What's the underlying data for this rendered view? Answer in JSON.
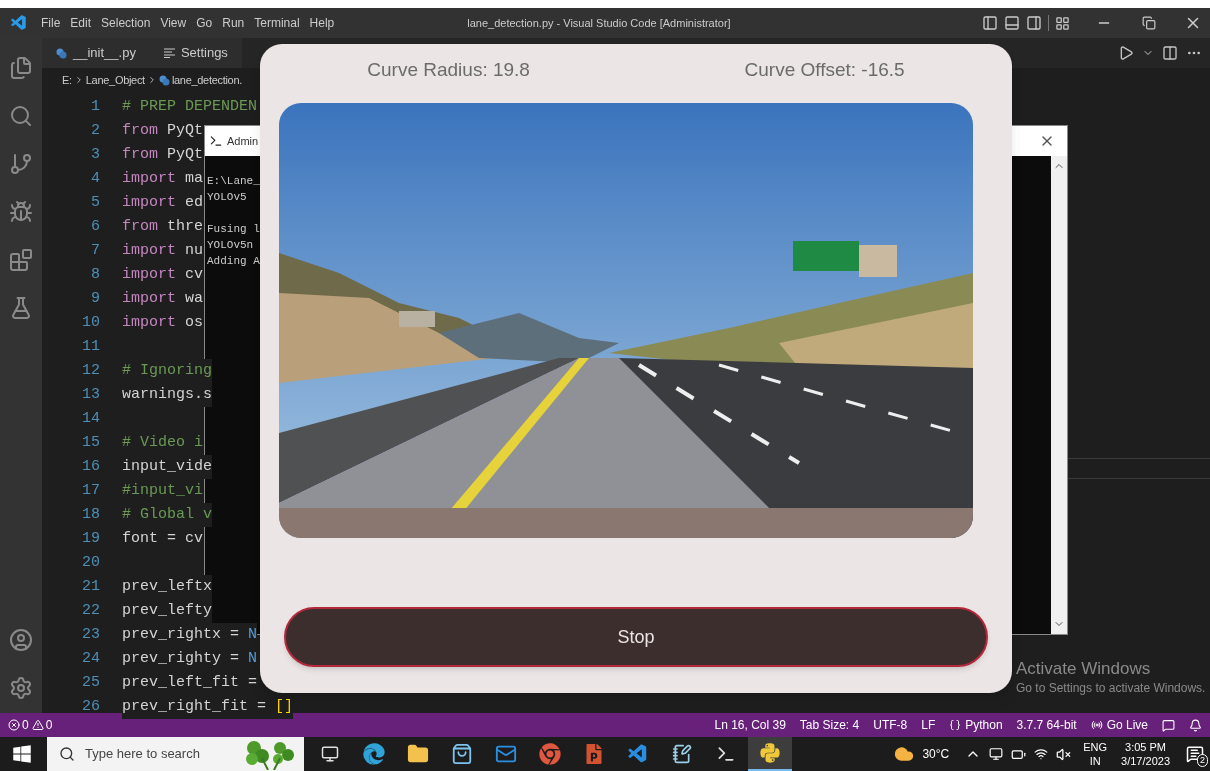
{
  "vscode": {
    "menu": [
      "File",
      "Edit",
      "Selection",
      "View",
      "Go",
      "Run",
      "Terminal",
      "Help"
    ],
    "title": "lane_detection.py - Visual Studio Code [Administrator]",
    "tabs": [
      {
        "label": "__init__.py",
        "kind": "python",
        "selected": false
      },
      {
        "label": "Settings",
        "kind": "settings",
        "selected": false
      }
    ],
    "breadcrumb": [
      {
        "label": "E:",
        "kind": "folder"
      },
      {
        "label": "Lane_Object",
        "kind": "folder"
      },
      {
        "label": "lane_detection.",
        "kind": "python"
      }
    ],
    "code_lines": [
      {
        "number": "1",
        "tokens": [
          {
            "text": "# PREP DEPENDEN",
            "kind": "comment"
          }
        ]
      },
      {
        "number": "2",
        "tokens": [
          {
            "text": "from",
            "kind": "keyword"
          },
          {
            "text": " PyQt",
            "kind": "plain"
          }
        ]
      },
      {
        "number": "3",
        "tokens": [
          {
            "text": "from",
            "kind": "keyword"
          },
          {
            "text": " PyQt",
            "kind": "plain"
          }
        ]
      },
      {
        "number": "4",
        "tokens": [
          {
            "text": "import",
            "kind": "keyword"
          },
          {
            "text": " ma",
            "kind": "plain"
          }
        ]
      },
      {
        "number": "5",
        "tokens": [
          {
            "text": "import",
            "kind": "keyword"
          },
          {
            "text": " ed",
            "kind": "plain"
          }
        ]
      },
      {
        "number": "6",
        "tokens": [
          {
            "text": "from",
            "kind": "keyword"
          },
          {
            "text": " thre",
            "kind": "plain"
          }
        ]
      },
      {
        "number": "7",
        "tokens": [
          {
            "text": "import",
            "kind": "keyword"
          },
          {
            "text": " nu",
            "kind": "plain"
          }
        ]
      },
      {
        "number": "8",
        "tokens": [
          {
            "text": "import",
            "kind": "keyword"
          },
          {
            "text": " cv",
            "kind": "plain"
          }
        ]
      },
      {
        "number": "9",
        "tokens": [
          {
            "text": "import",
            "kind": "keyword"
          },
          {
            "text": " wa",
            "kind": "plain"
          }
        ]
      },
      {
        "number": "10",
        "tokens": [
          {
            "text": "import",
            "kind": "keyword"
          },
          {
            "text": " os",
            "kind": "plain"
          }
        ]
      },
      {
        "number": "11"
      },
      {
        "number": "12",
        "tokens": [
          {
            "text": "# Ignoring",
            "kind": "comment"
          }
        ]
      },
      {
        "number": "13",
        "tokens": [
          {
            "text": "warnings.s",
            "kind": "plain"
          }
        ]
      },
      {
        "number": "14"
      },
      {
        "number": "15",
        "tokens": [
          {
            "text": "# Video i",
            "kind": "comment"
          }
        ]
      },
      {
        "number": "16",
        "tokens": [
          {
            "text": "input_vide",
            "kind": "plain"
          }
        ]
      },
      {
        "number": "17",
        "tokens": [
          {
            "text": "#input_vi",
            "kind": "comment"
          }
        ]
      },
      {
        "number": "18",
        "tokens": [
          {
            "text": "# Global v",
            "kind": "comment"
          }
        ]
      },
      {
        "number": "19",
        "tokens": [
          {
            "text": "font = cv",
            "kind": "plain"
          }
        ]
      },
      {
        "number": "20"
      },
      {
        "number": "21",
        "tokens": [
          {
            "text": "prev_leftx",
            "kind": "plain"
          }
        ]
      },
      {
        "number": "22",
        "tokens": [
          {
            "text": "prev_lefty",
            "kind": "plain"
          }
        ]
      },
      {
        "number": "23",
        "tokens": [
          {
            "text": "prev_rightx = ",
            "kind": "plain"
          },
          {
            "text": "N",
            "kind": "constant"
          }
        ]
      },
      {
        "number": "24",
        "tokens": [
          {
            "text": "prev_righty = ",
            "kind": "plain"
          },
          {
            "text": "N",
            "kind": "constant"
          }
        ]
      },
      {
        "number": "25",
        "tokens": [
          {
            "text": "prev_left_fit =",
            "kind": "plain"
          }
        ]
      },
      {
        "number": "26",
        "tokens": [
          {
            "text": "prev_right_fit = ",
            "kind": "plain"
          },
          {
            "text": "[]",
            "kind": "bracket"
          }
        ]
      }
    ],
    "status_bar": {
      "errors": "0",
      "warnings": "0",
      "items": [
        {
          "label": "Ln 16, Col 39",
          "kind": "text"
        },
        {
          "label": "Tab Size: 4",
          "kind": "text"
        },
        {
          "label": "UTF-8",
          "kind": "text"
        },
        {
          "label": "LF",
          "kind": "text"
        },
        {
          "label": "Python",
          "kind": "language"
        },
        {
          "label": "3.7.7 64-bit",
          "kind": "text"
        },
        {
          "label": "Go Live",
          "kind": "live"
        }
      ]
    }
  },
  "console": {
    "title": "Admin",
    "blocks": [
      [
        "E:\\Lane_",
        "YOLOv5"
      ],
      [
        "Fusing l",
        "YOLOv5n",
        "Adding A"
      ]
    ]
  },
  "app": {
    "curve_radius": "Curve Radius: 19.8",
    "curve_offset": "Curve Offset: -16.5",
    "button": "Stop"
  },
  "activation_notice": {
    "title": "Activate Windows",
    "subtitle": "Go to Settings to activate Windows."
  },
  "taskbar": {
    "search": {
      "placeholder": "Type here to search"
    },
    "apps": [
      {
        "kind": "taskview",
        "selected": false
      },
      {
        "kind": "browser",
        "selected": false
      },
      {
        "kind": "folder",
        "selected": false
      },
      {
        "kind": "store",
        "selected": false
      },
      {
        "kind": "mail",
        "selected": false
      },
      {
        "kind": "chrome",
        "selected": false
      },
      {
        "kind": "slides",
        "selected": false
      },
      {
        "kind": "editor",
        "selected": false
      },
      {
        "kind": "notepad",
        "selected": false
      },
      {
        "kind": "terminal",
        "selected": false
      },
      {
        "kind": "python",
        "selected": true
      }
    ],
    "weather": "30°C",
    "language": "ENG",
    "region": "IN",
    "time": "3:05 PM",
    "date": "3/17/2023",
    "notifications": "2"
  }
}
